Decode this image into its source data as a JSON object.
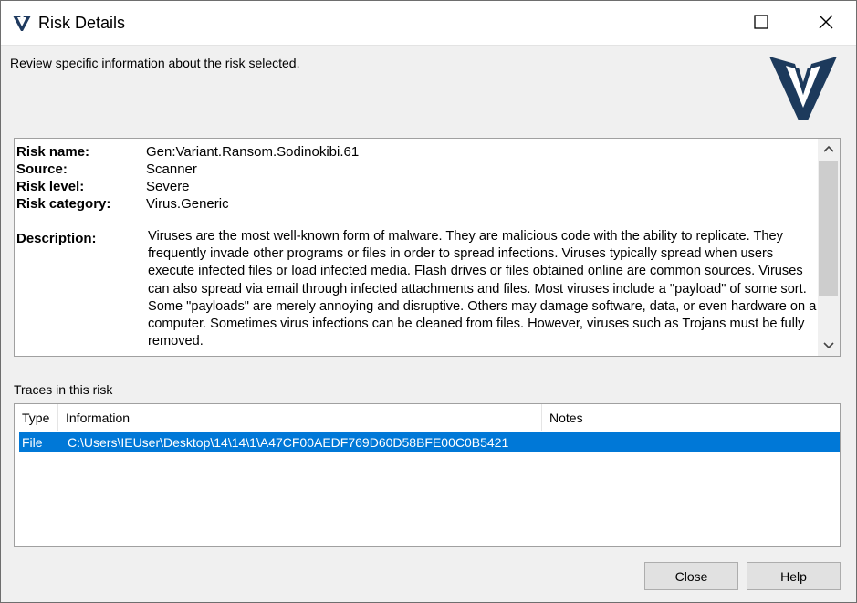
{
  "window": {
    "title": "Risk Details",
    "icon": "vipre-logo-icon"
  },
  "header": {
    "text": "Review specific information about the risk selected.",
    "logo": "vipre-logo-icon"
  },
  "details": {
    "risk_name_label": "Risk name:",
    "risk_name_value": "Gen:Variant.Ransom.Sodinokibi.61",
    "source_label": "Source:",
    "source_value": "Scanner",
    "risk_level_label": "Risk level:",
    "risk_level_value": "Severe",
    "risk_category_label": "Risk category:",
    "risk_category_value": "Virus.Generic",
    "description_label": "Description:",
    "description_value": "Viruses are the most well-known form of malware. They are malicious code with the ability to replicate. They frequently invade other programs or files in order to spread infections. Viruses typically spread when users execute infected files or load infected media. Flash drives or files obtained online are common sources. Viruses can also spread via email through infected attachments and files. Most viruses include a \"payload\" of some sort. Some \"payloads\" are merely annoying and disruptive. Others may damage software, data, or even hardware on a computer. Sometimes virus infections can be cleaned from files. However, viruses such as Trojans must be fully removed."
  },
  "traces": {
    "label": "Traces in this risk",
    "columns": {
      "type": "Type",
      "information": "Information",
      "notes": "Notes"
    },
    "rows": [
      {
        "type": "File",
        "information": "C:\\Users\\IEUser\\Desktop\\14\\14\\1\\A47CF00AEDF769D60D58BFE00C0B5421",
        "notes": ""
      }
    ]
  },
  "buttons": {
    "close": "Close",
    "help": "Help"
  },
  "colors": {
    "selection": "#0078d7",
    "logo_blue": "#1d3557"
  }
}
